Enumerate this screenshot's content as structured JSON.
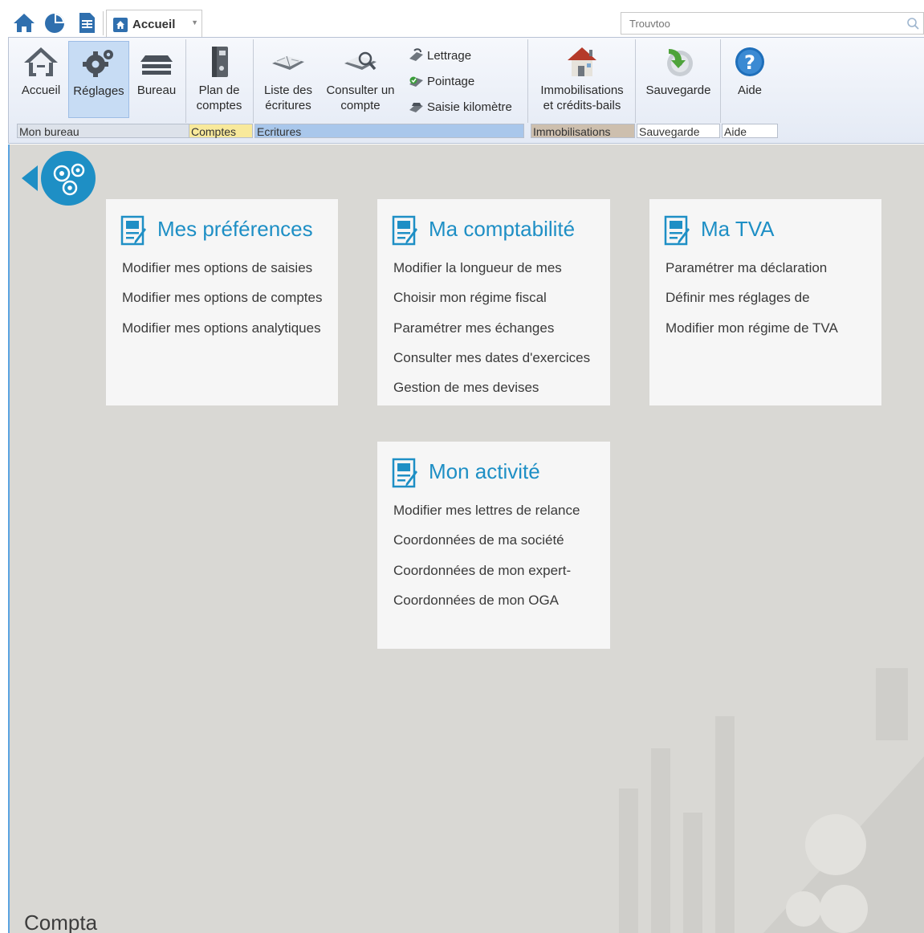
{
  "top_bar": {
    "quick_access_icons": [
      "home-icon",
      "pie-chart-icon",
      "document-icon"
    ],
    "tab_label": "Accueil",
    "search_placeholder": "Trouvtoo"
  },
  "ribbon": {
    "groups": {
      "bureau": "Mon bureau",
      "comptes": "Comptes",
      "ecritures": "Ecritures",
      "immobilisations": "Immobilisations",
      "sauvegarde": "Sauvegarde",
      "aide": "Aide"
    },
    "buttons": {
      "accueil": "Accueil",
      "reglages": "Réglages",
      "bureau": "Bureau",
      "plan_line1": "Plan de",
      "plan_line2": "comptes",
      "liste_line1": "Liste des",
      "liste_line2": "écritures",
      "consulter_line1": "Consulter un",
      "consulter_line2": "compte",
      "lettrage": "Lettrage",
      "pointage": "Pointage",
      "saisie_km": "Saisie kilomètre",
      "immo_line1": "Immobilisations",
      "immo_line2": "et crédits-bails",
      "sauvegarde": "Sauvegarde",
      "aide": "Aide"
    },
    "active_button": "Réglages"
  },
  "cards": {
    "preferences": {
      "title": "Mes préférences",
      "items": [
        "Modifier mes options de saisies",
        "Modifier mes options de comptes",
        "Modifier mes options analytiques"
      ]
    },
    "comptabilite": {
      "title": "Ma comptabilité",
      "items": [
        "Modifier la longueur de mes",
        "Choisir mon régime fiscal",
        "Paramétrer mes échanges",
        "Consulter mes dates d'exercices",
        "Gestion de mes devises"
      ]
    },
    "tva": {
      "title": "Ma TVA",
      "items": [
        "Paramétrer ma déclaration",
        "Définir mes réglages de",
        "Modifier mon régime de TVA"
      ]
    },
    "activite": {
      "title": "Mon activité",
      "items": [
        "Modifier mes lettres de relance",
        "Coordonnées de ma société",
        "Coordonnées de mon expert-",
        "Coordonnées de mon OGA"
      ]
    }
  },
  "footer": {
    "label": "Compta"
  },
  "colors": {
    "accent_blue": "#1e8fc5",
    "main_bg": "#d9d8d4",
    "card_bg": "#f6f6f6",
    "comptes_group": "#f8e99b",
    "ecritures_group": "#a9c7eb",
    "immobilisations_group": "#cdbfae"
  }
}
